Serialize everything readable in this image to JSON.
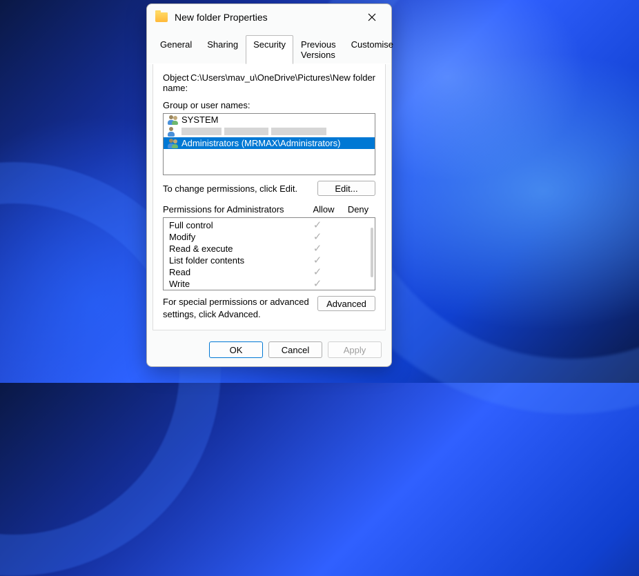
{
  "window": {
    "title": "New folder Properties"
  },
  "tabs": {
    "general": "General",
    "sharing": "Sharing",
    "security": "Security",
    "previous": "Previous Versions",
    "customise": "Customise",
    "active": "security"
  },
  "security": {
    "object_label": "Object name:",
    "object_value": "C:\\Users\\mav_u\\OneDrive\\Pictures\\New folder",
    "group_label": "Group or user names:",
    "users": [
      {
        "name": "SYSTEM",
        "selected": false,
        "redacted": false
      },
      {
        "name": "",
        "selected": false,
        "redacted": true
      },
      {
        "name": "Administrators (MRMAX\\Administrators)",
        "selected": true,
        "redacted": false
      }
    ],
    "edit_text": "To change permissions, click Edit.",
    "edit_button": "Edit...",
    "permissions_label": "Permissions for Administrators",
    "allow_label": "Allow",
    "deny_label": "Deny",
    "permissions": [
      {
        "name": "Full control",
        "allow": true,
        "deny": false
      },
      {
        "name": "Modify",
        "allow": true,
        "deny": false
      },
      {
        "name": "Read & execute",
        "allow": true,
        "deny": false
      },
      {
        "name": "List folder contents",
        "allow": true,
        "deny": false
      },
      {
        "name": "Read",
        "allow": true,
        "deny": false
      },
      {
        "name": "Write",
        "allow": true,
        "deny": false
      }
    ],
    "advanced_text": "For special permissions or advanced settings, click Advanced.",
    "advanced_button": "Advanced"
  },
  "buttons": {
    "ok": "OK",
    "cancel": "Cancel",
    "apply": "Apply"
  }
}
